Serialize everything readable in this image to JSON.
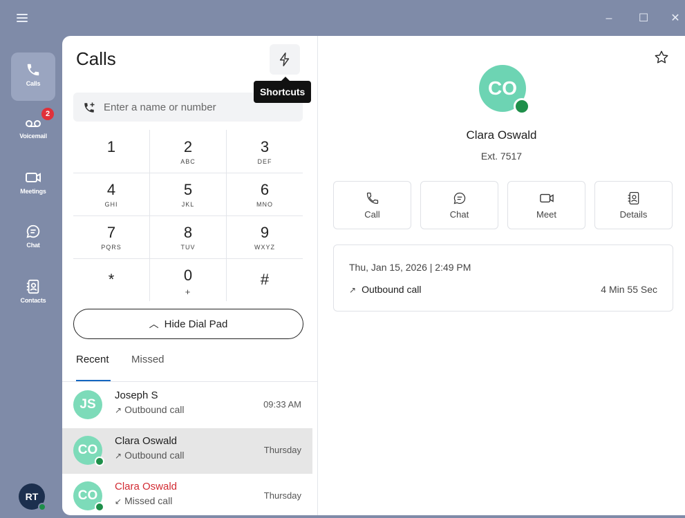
{
  "window": {
    "minimize": "–",
    "maximize": "☐",
    "close": "✕"
  },
  "rail": {
    "items": [
      {
        "label": "Calls",
        "icon": "phone-icon"
      },
      {
        "label": "Voicemail",
        "icon": "voicemail-icon",
        "badge": "2"
      },
      {
        "label": "Meetings",
        "icon": "video-icon"
      },
      {
        "label": "Chat",
        "icon": "chat-icon"
      },
      {
        "label": "Contacts",
        "icon": "contacts-icon"
      }
    ],
    "user_initials": "RT"
  },
  "calls": {
    "title": "Calls",
    "shortcuts_tooltip": "Shortcuts",
    "search_placeholder": "Enter a name or number",
    "dialpad": [
      {
        "digit": "1",
        "letters": ""
      },
      {
        "digit": "2",
        "letters": "ABC"
      },
      {
        "digit": "3",
        "letters": "DEF"
      },
      {
        "digit": "4",
        "letters": "GHI"
      },
      {
        "digit": "5",
        "letters": "JKL"
      },
      {
        "digit": "6",
        "letters": "MNO"
      },
      {
        "digit": "7",
        "letters": "PQRS"
      },
      {
        "digit": "8",
        "letters": "TUV"
      },
      {
        "digit": "9",
        "letters": "WXYZ"
      },
      {
        "digit": "*",
        "letters": ""
      },
      {
        "digit": "0",
        "letters": "+"
      },
      {
        "digit": "#",
        "letters": ""
      }
    ],
    "hide_dial_pad": "Hide Dial Pad",
    "tabs": {
      "recent": "Recent",
      "missed": "Missed"
    },
    "history": [
      {
        "initials": "JS",
        "name": "Joseph S",
        "status": "Outbound call",
        "arrow": "↗",
        "time": "09:33 AM",
        "missed": false,
        "online": false
      },
      {
        "initials": "CO",
        "name": "Clara Oswald",
        "status": "Outbound call",
        "arrow": "↗",
        "time": "Thursday",
        "missed": false,
        "online": true
      },
      {
        "initials": "CO",
        "name": "Clara Oswald",
        "status": "Missed call",
        "arrow": "↙",
        "time": "Thursday",
        "missed": true,
        "online": true
      }
    ]
  },
  "contact": {
    "initials": "CO",
    "name": "Clara Oswald",
    "ext": "Ext. 7517",
    "actions": [
      {
        "label": "Call",
        "icon": "phone-icon"
      },
      {
        "label": "Chat",
        "icon": "chat-icon"
      },
      {
        "label": "Meet",
        "icon": "video-icon"
      },
      {
        "label": "Details",
        "icon": "contacts-icon"
      }
    ],
    "last_call": {
      "date": "Thu, Jan 15, 2026 | 2:49 PM",
      "type": "Outbound call",
      "arrow": "↗",
      "duration": "4 Min 55 Sec"
    }
  },
  "colors": {
    "background": "#7f8ba8",
    "avatar": "#7ddbb9",
    "presence": "#1e8f4a",
    "badge": "#e0313a",
    "accent": "#1566c0",
    "missed": "#d22a32"
  }
}
